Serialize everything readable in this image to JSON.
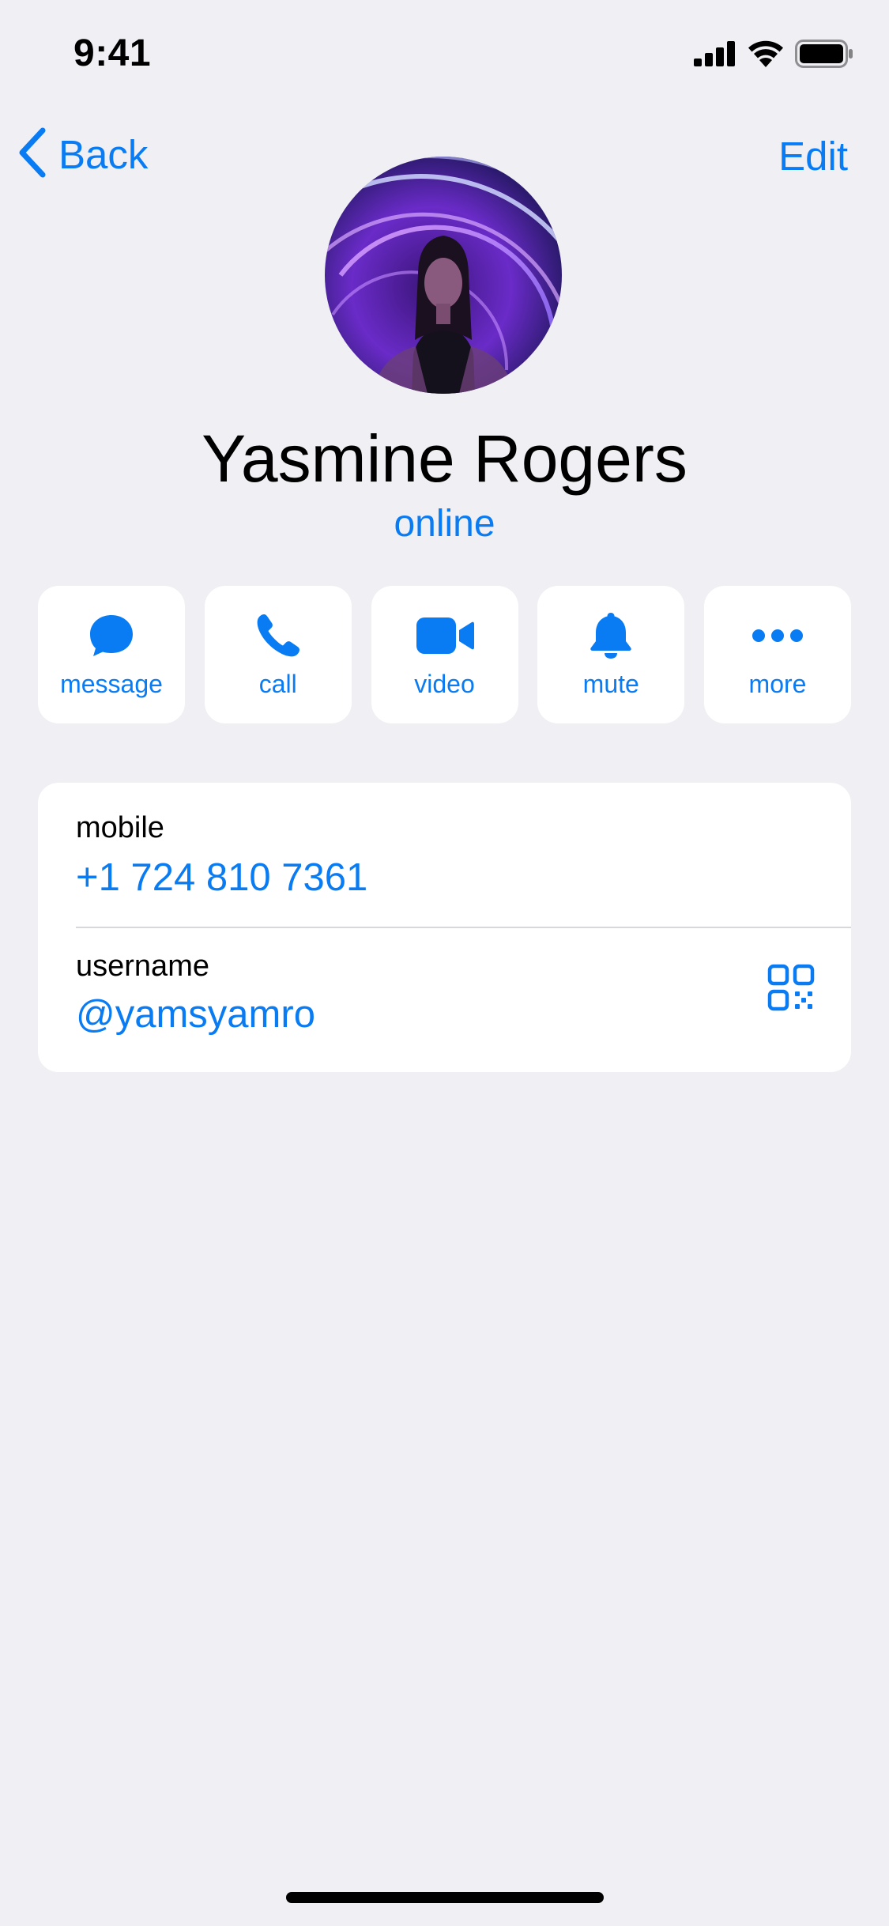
{
  "status_bar": {
    "time": "9:41"
  },
  "nav": {
    "back_label": "Back",
    "edit_label": "Edit"
  },
  "profile": {
    "name": "Yasmine Rogers",
    "status": "online"
  },
  "actions": [
    {
      "label": "message",
      "icon": "chat-bubble-icon"
    },
    {
      "label": "call",
      "icon": "phone-icon"
    },
    {
      "label": "video",
      "icon": "video-camera-icon"
    },
    {
      "label": "mute",
      "icon": "bell-icon"
    },
    {
      "label": "more",
      "icon": "ellipsis-icon"
    }
  ],
  "info": {
    "mobile_label": "mobile",
    "mobile_value": "+1 724 810 7361",
    "username_label": "username",
    "username_value": "@yamsyamro"
  },
  "colors": {
    "accent": "#0a7cf3",
    "background": "#efeff4",
    "card": "#ffffff"
  }
}
